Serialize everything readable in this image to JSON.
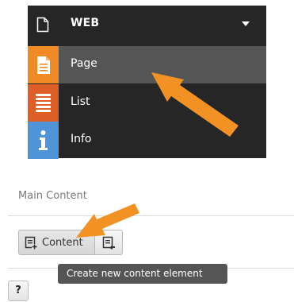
{
  "module_menu": {
    "header": {
      "title": "WEB",
      "icon": "document-icon",
      "toggle_icon": "caret-down-icon"
    },
    "items": [
      {
        "label": "Page",
        "icon": "page-module-icon",
        "icon_color": "#f08a24",
        "active": true
      },
      {
        "label": "List",
        "icon": "list-module-icon",
        "icon_color": "#dd5e27",
        "active": false
      },
      {
        "label": "Info",
        "icon": "info-module-icon",
        "icon_color": "#4e94d6",
        "active": false
      }
    ]
  },
  "content_area": {
    "section_title": "Main Content",
    "new_content_button": {
      "label": "Content",
      "icon": "add-content-icon"
    },
    "paste_button": {
      "icon": "paste-content-icon"
    },
    "tooltip": "Create new content element",
    "help_button": {
      "label": "?"
    }
  },
  "annotations": {
    "arrow_color": "#f39224"
  }
}
